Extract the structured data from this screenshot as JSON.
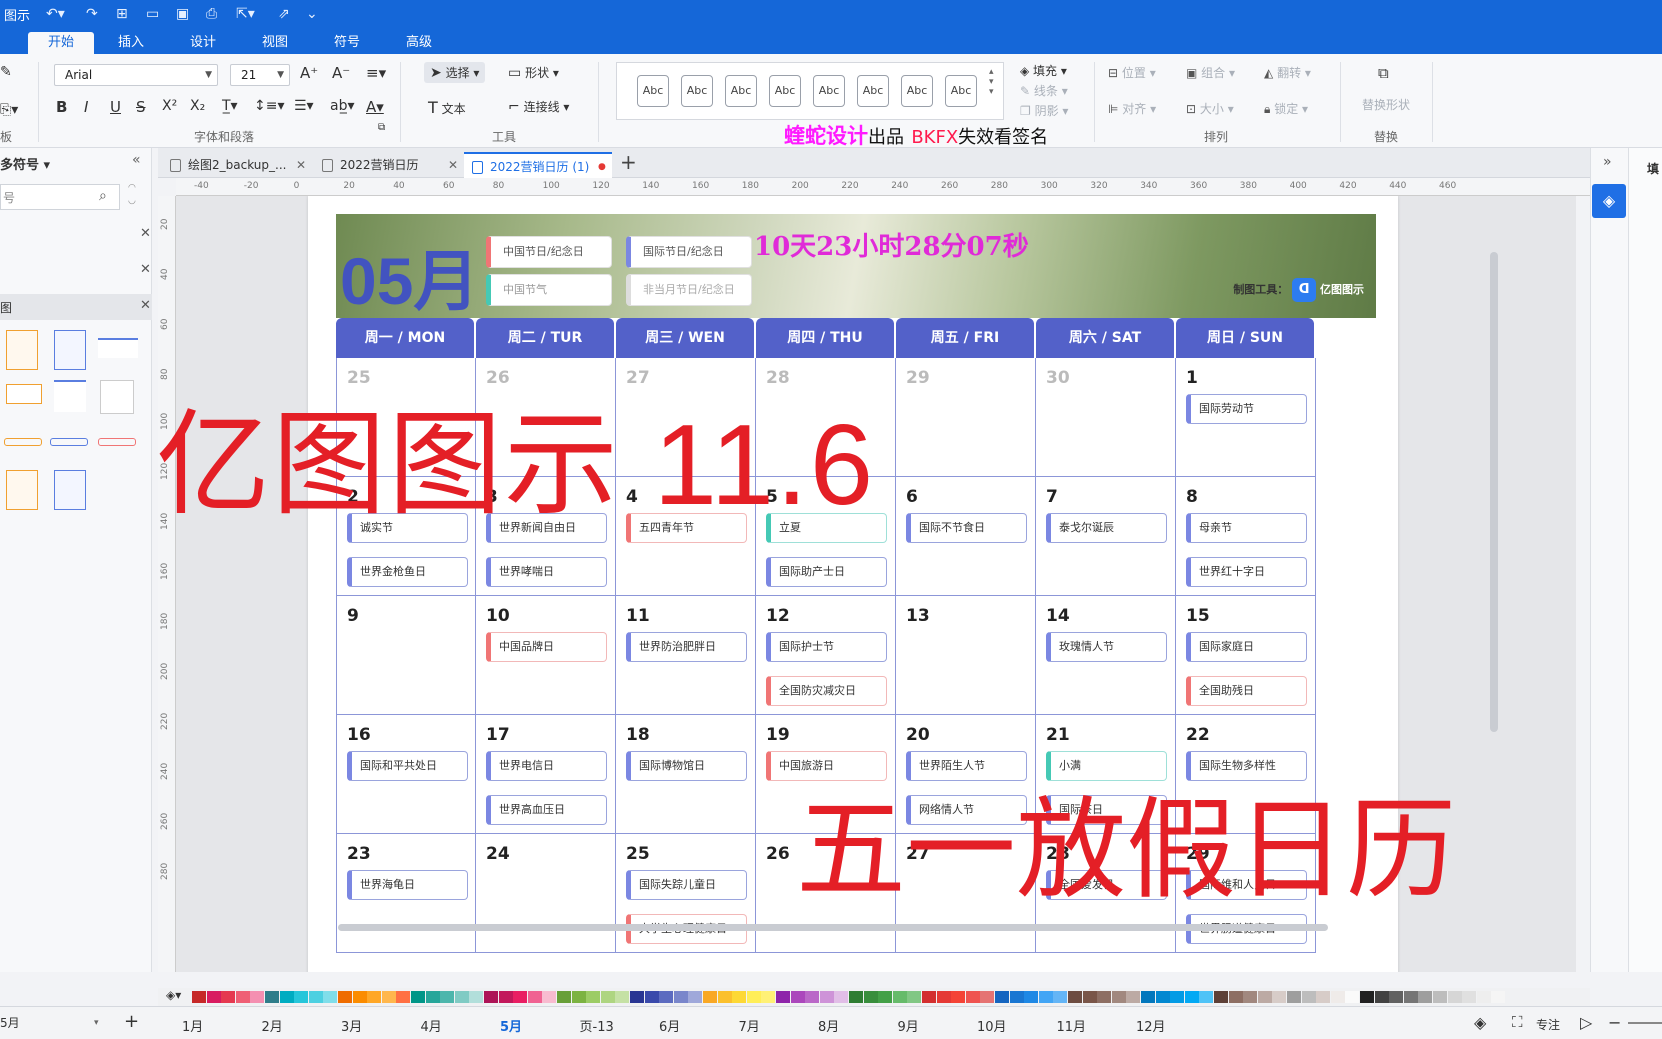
{
  "titlebar": {
    "app_fragment": "图示"
  },
  "ribbon_tabs": [
    "开始",
    "插入",
    "设计",
    "视图",
    "符号",
    "高级"
  ],
  "ribbon": {
    "font_name": "Arial",
    "font_size": "21",
    "select_label": "选择",
    "shape_label": "形状",
    "text_label": "文本",
    "connector_label": "连接线",
    "fill_label": "填充",
    "line_label": "线条",
    "shadow_label": "阴影",
    "position_label": "位置",
    "group_label": "组合",
    "flip_label": "翻转",
    "align_label": "对齐",
    "size_label": "大小",
    "lock_label": "锁定",
    "replace_shape_label": "替换形状",
    "style_sample": "Abc",
    "group_font_para": "字体和段落",
    "group_tools": "工具",
    "group_arrange": "排列",
    "group_replace": "替换",
    "group_board": "板",
    "watermark_pink": "蝰蛇设计",
    "watermark_black1": "出品",
    "watermark_red": "BKFX",
    "watermark_black2": "失效看签名"
  },
  "left_panel": {
    "title": "多符号",
    "search_placeholder": "号",
    "section": "图"
  },
  "doc_tabs": [
    "绘图2_backup_...",
    "2022营销日历",
    "2022营销日历 (1)"
  ],
  "hruler_labels": [
    "-40",
    "-20",
    "0",
    "20",
    "40",
    "60",
    "80",
    "100",
    "120",
    "140",
    "160",
    "180",
    "200",
    "220",
    "240",
    "260",
    "280",
    "300",
    "320",
    "340",
    "360",
    "380",
    "400",
    "420",
    "440",
    "460"
  ],
  "vruler_labels": [
    "20",
    "40",
    "60",
    "80",
    "100",
    "120",
    "140",
    "160",
    "180",
    "200",
    "220",
    "240",
    "260",
    "280"
  ],
  "calendar": {
    "month": "05月",
    "legends": [
      "中国节日/纪念日",
      "国际节日/纪念日",
      "中国节气",
      "非当月节日/纪念日"
    ],
    "countdown": "10天23小时28分07秒",
    "maker_label": "制图工具：",
    "maker_name": "亿图图示",
    "weekdays": [
      "周一 / MON",
      "周二 / TUR",
      "周三 / WEN",
      "周四 / THU",
      "周五 / FRI",
      "周六 / SAT",
      "周日 / SUN"
    ],
    "weeks": [
      [
        {
          "d": "25",
          "o": true,
          "e": []
        },
        {
          "d": "26",
          "o": true,
          "e": []
        },
        {
          "d": "27",
          "o": true,
          "e": []
        },
        {
          "d": "28",
          "o": true,
          "e": []
        },
        {
          "d": "29",
          "o": true,
          "e": []
        },
        {
          "d": "30",
          "o": true,
          "e": []
        },
        {
          "d": "1",
          "e": [
            [
              "国际劳动节",
              "b"
            ]
          ]
        }
      ],
      [
        {
          "d": "2",
          "e": [
            [
              "诚实节",
              "b"
            ],
            [
              "世界金枪鱼日",
              "b"
            ]
          ]
        },
        {
          "d": "3",
          "e": [
            [
              "世界新闻自由日",
              "b"
            ],
            [
              "世界哮喘日",
              "b"
            ]
          ]
        },
        {
          "d": "4",
          "e": [
            [
              "五四青年节",
              "r"
            ]
          ]
        },
        {
          "d": "5",
          "e": [
            [
              "立夏",
              "t"
            ],
            [
              "国际助产士日",
              "b"
            ]
          ]
        },
        {
          "d": "6",
          "e": [
            [
              "国际不节食日",
              "b"
            ]
          ]
        },
        {
          "d": "7",
          "e": [
            [
              "泰戈尔诞辰",
              "b"
            ]
          ]
        },
        {
          "d": "8",
          "e": [
            [
              "母亲节",
              "b"
            ],
            [
              "世界红十字日",
              "b"
            ]
          ]
        }
      ],
      [
        {
          "d": "9",
          "e": []
        },
        {
          "d": "10",
          "e": [
            [
              "中国品牌日",
              "r"
            ]
          ]
        },
        {
          "d": "11",
          "e": [
            [
              "世界防治肥胖日",
              "b"
            ]
          ]
        },
        {
          "d": "12",
          "e": [
            [
              "国际护士节",
              "b"
            ],
            [
              "全国防灾减灾日",
              "r"
            ]
          ]
        },
        {
          "d": "13",
          "e": []
        },
        {
          "d": "14",
          "e": [
            [
              "玫瑰情人节",
              "b"
            ]
          ]
        },
        {
          "d": "15",
          "e": [
            [
              "国际家庭日",
              "b"
            ],
            [
              "全国助残日",
              "r"
            ]
          ]
        }
      ],
      [
        {
          "d": "16",
          "e": [
            [
              "国际和平共处日",
              "b"
            ]
          ]
        },
        {
          "d": "17",
          "e": [
            [
              "世界电信日",
              "b"
            ],
            [
              "世界高血压日",
              "b"
            ]
          ]
        },
        {
          "d": "18",
          "e": [
            [
              "国际博物馆日",
              "b"
            ]
          ]
        },
        {
          "d": "19",
          "e": [
            [
              "中国旅游日",
              "r"
            ]
          ]
        },
        {
          "d": "20",
          "e": [
            [
              "世界陌生人节",
              "b"
            ],
            [
              "网络情人节",
              "b"
            ]
          ]
        },
        {
          "d": "21",
          "e": [
            [
              "小满",
              "t"
            ],
            [
              "国际茶日",
              "b"
            ]
          ]
        },
        {
          "d": "22",
          "e": [
            [
              "国际生物多样性",
              "b"
            ]
          ]
        }
      ],
      [
        {
          "d": "23",
          "e": [
            [
              "世界海龟日",
              "b"
            ]
          ]
        },
        {
          "d": "24",
          "e": []
        },
        {
          "d": "25",
          "e": [
            [
              "国际失踪儿童日",
              "b"
            ],
            [
              "大学生心理健康日",
              "r"
            ]
          ]
        },
        {
          "d": "26",
          "e": []
        },
        {
          "d": "27",
          "e": []
        },
        {
          "d": "28",
          "e": [
            [
              "全国爱发日",
              "b"
            ]
          ]
        },
        {
          "d": "29",
          "e": [
            [
              "国际维和人员日",
              "b"
            ],
            [
              "世界肠道健康日",
              "b"
            ]
          ]
        }
      ]
    ]
  },
  "overlays": {
    "big_title": "亿图图示 11.6",
    "subtitle": "五一放假日历"
  },
  "statusbar": {
    "current_page": "5月",
    "pages": [
      "1月",
      "2月",
      "3月",
      "4月",
      "5月",
      "页-13",
      "6月",
      "7月",
      "8月",
      "9月",
      "10月",
      "11月",
      "12月"
    ],
    "active_page": "5月",
    "focus_label": "专注"
  },
  "right_panel": {
    "title": "填"
  },
  "palette": [
    "#c62828",
    "#d81b60",
    "#e53950",
    "#ef5f75",
    "#f48fb1",
    "#2e7d8a",
    "#00acc1",
    "#26c6da",
    "#4dd0e1",
    "#80deea",
    "#ef6c00",
    "#fb8c00",
    "#ffa726",
    "#ffb74d",
    "#ff7043",
    "#009688",
    "#26a69a",
    "#4db6ac",
    "#80cbc4",
    "#b2dfdb",
    "#ad1457",
    "#c2185b",
    "#e91e63",
    "#f06292",
    "#f8bbd0",
    "#689f38",
    "#7cb342",
    "#9ccc65",
    "#aed581",
    "#c5e1a5",
    "#283593",
    "#3949ab",
    "#5c6bc0",
    "#7986cb",
    "#9fa8da",
    "#f9a825",
    "#fbc02d",
    "#fdd835",
    "#ffee58",
    "#fff176",
    "#8e24aa",
    "#ab47bc",
    "#ba68c8",
    "#ce93d8",
    "#e1bee7",
    "#2e7d32",
    "#388e3c",
    "#43a047",
    "#66bb6a",
    "#81c784",
    "#d32f2f",
    "#e53935",
    "#f44336",
    "#ef5350",
    "#e57373",
    "#1565c0",
    "#1976d2",
    "#1e88e5",
    "#42a5f5",
    "#64b5f6",
    "#6d4c41",
    "#795548",
    "#8d6e63",
    "#a1887f",
    "#bcaaa4",
    "#0277bd",
    "#0288d1",
    "#039be5",
    "#03a9f4",
    "#4fc3f7",
    "#5d4037",
    "#8d6e63",
    "#a1887f",
    "#bcaaa4",
    "#d7ccc8",
    "#9e9e9e",
    "#bdbdbd",
    "#d7ccc8",
    "#efebe9",
    "#fafafa",
    "#212121",
    "#424242",
    "#616161",
    "#757575",
    "#9e9e9e",
    "#bdbdbd",
    "#d6d6d6",
    "#e0e0e0",
    "#eeeeee",
    "#f5f5f5"
  ]
}
